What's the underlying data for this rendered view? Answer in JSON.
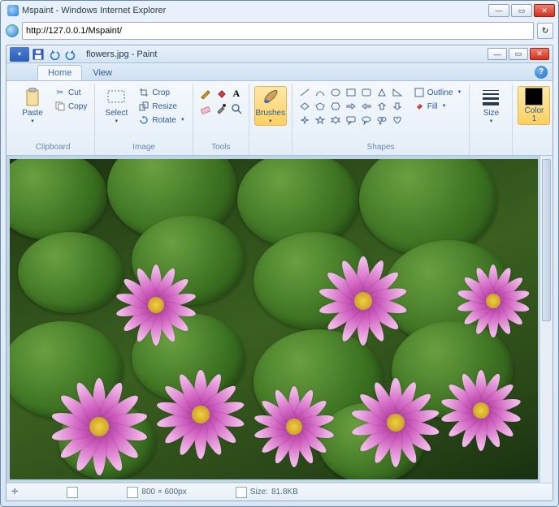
{
  "ie": {
    "title": "Mspaint - Windows Internet Explorer",
    "url": "http://127.0.0.1/Mspaint/"
  },
  "paint": {
    "title": "flowers.jpg - Paint",
    "tabs": {
      "home": "Home",
      "view": "View"
    },
    "clipboard": {
      "paste": "Paste",
      "cut": "Cut",
      "copy": "Copy",
      "label": "Clipboard"
    },
    "image": {
      "select": "Select",
      "crop": "Crop",
      "resize": "Resize",
      "rotate": "Rotate",
      "label": "Image"
    },
    "tools": {
      "label": "Tools"
    },
    "brushes": {
      "label": "Brushes"
    },
    "shapes": {
      "outline": "Outline",
      "fill": "Fill",
      "label": "Shapes"
    },
    "size": {
      "label": "Size"
    },
    "color": {
      "label": "Color\n1"
    }
  },
  "status": {
    "dim": "800 × 600px",
    "size_label": "Size:",
    "size_val": "81.8KB"
  }
}
